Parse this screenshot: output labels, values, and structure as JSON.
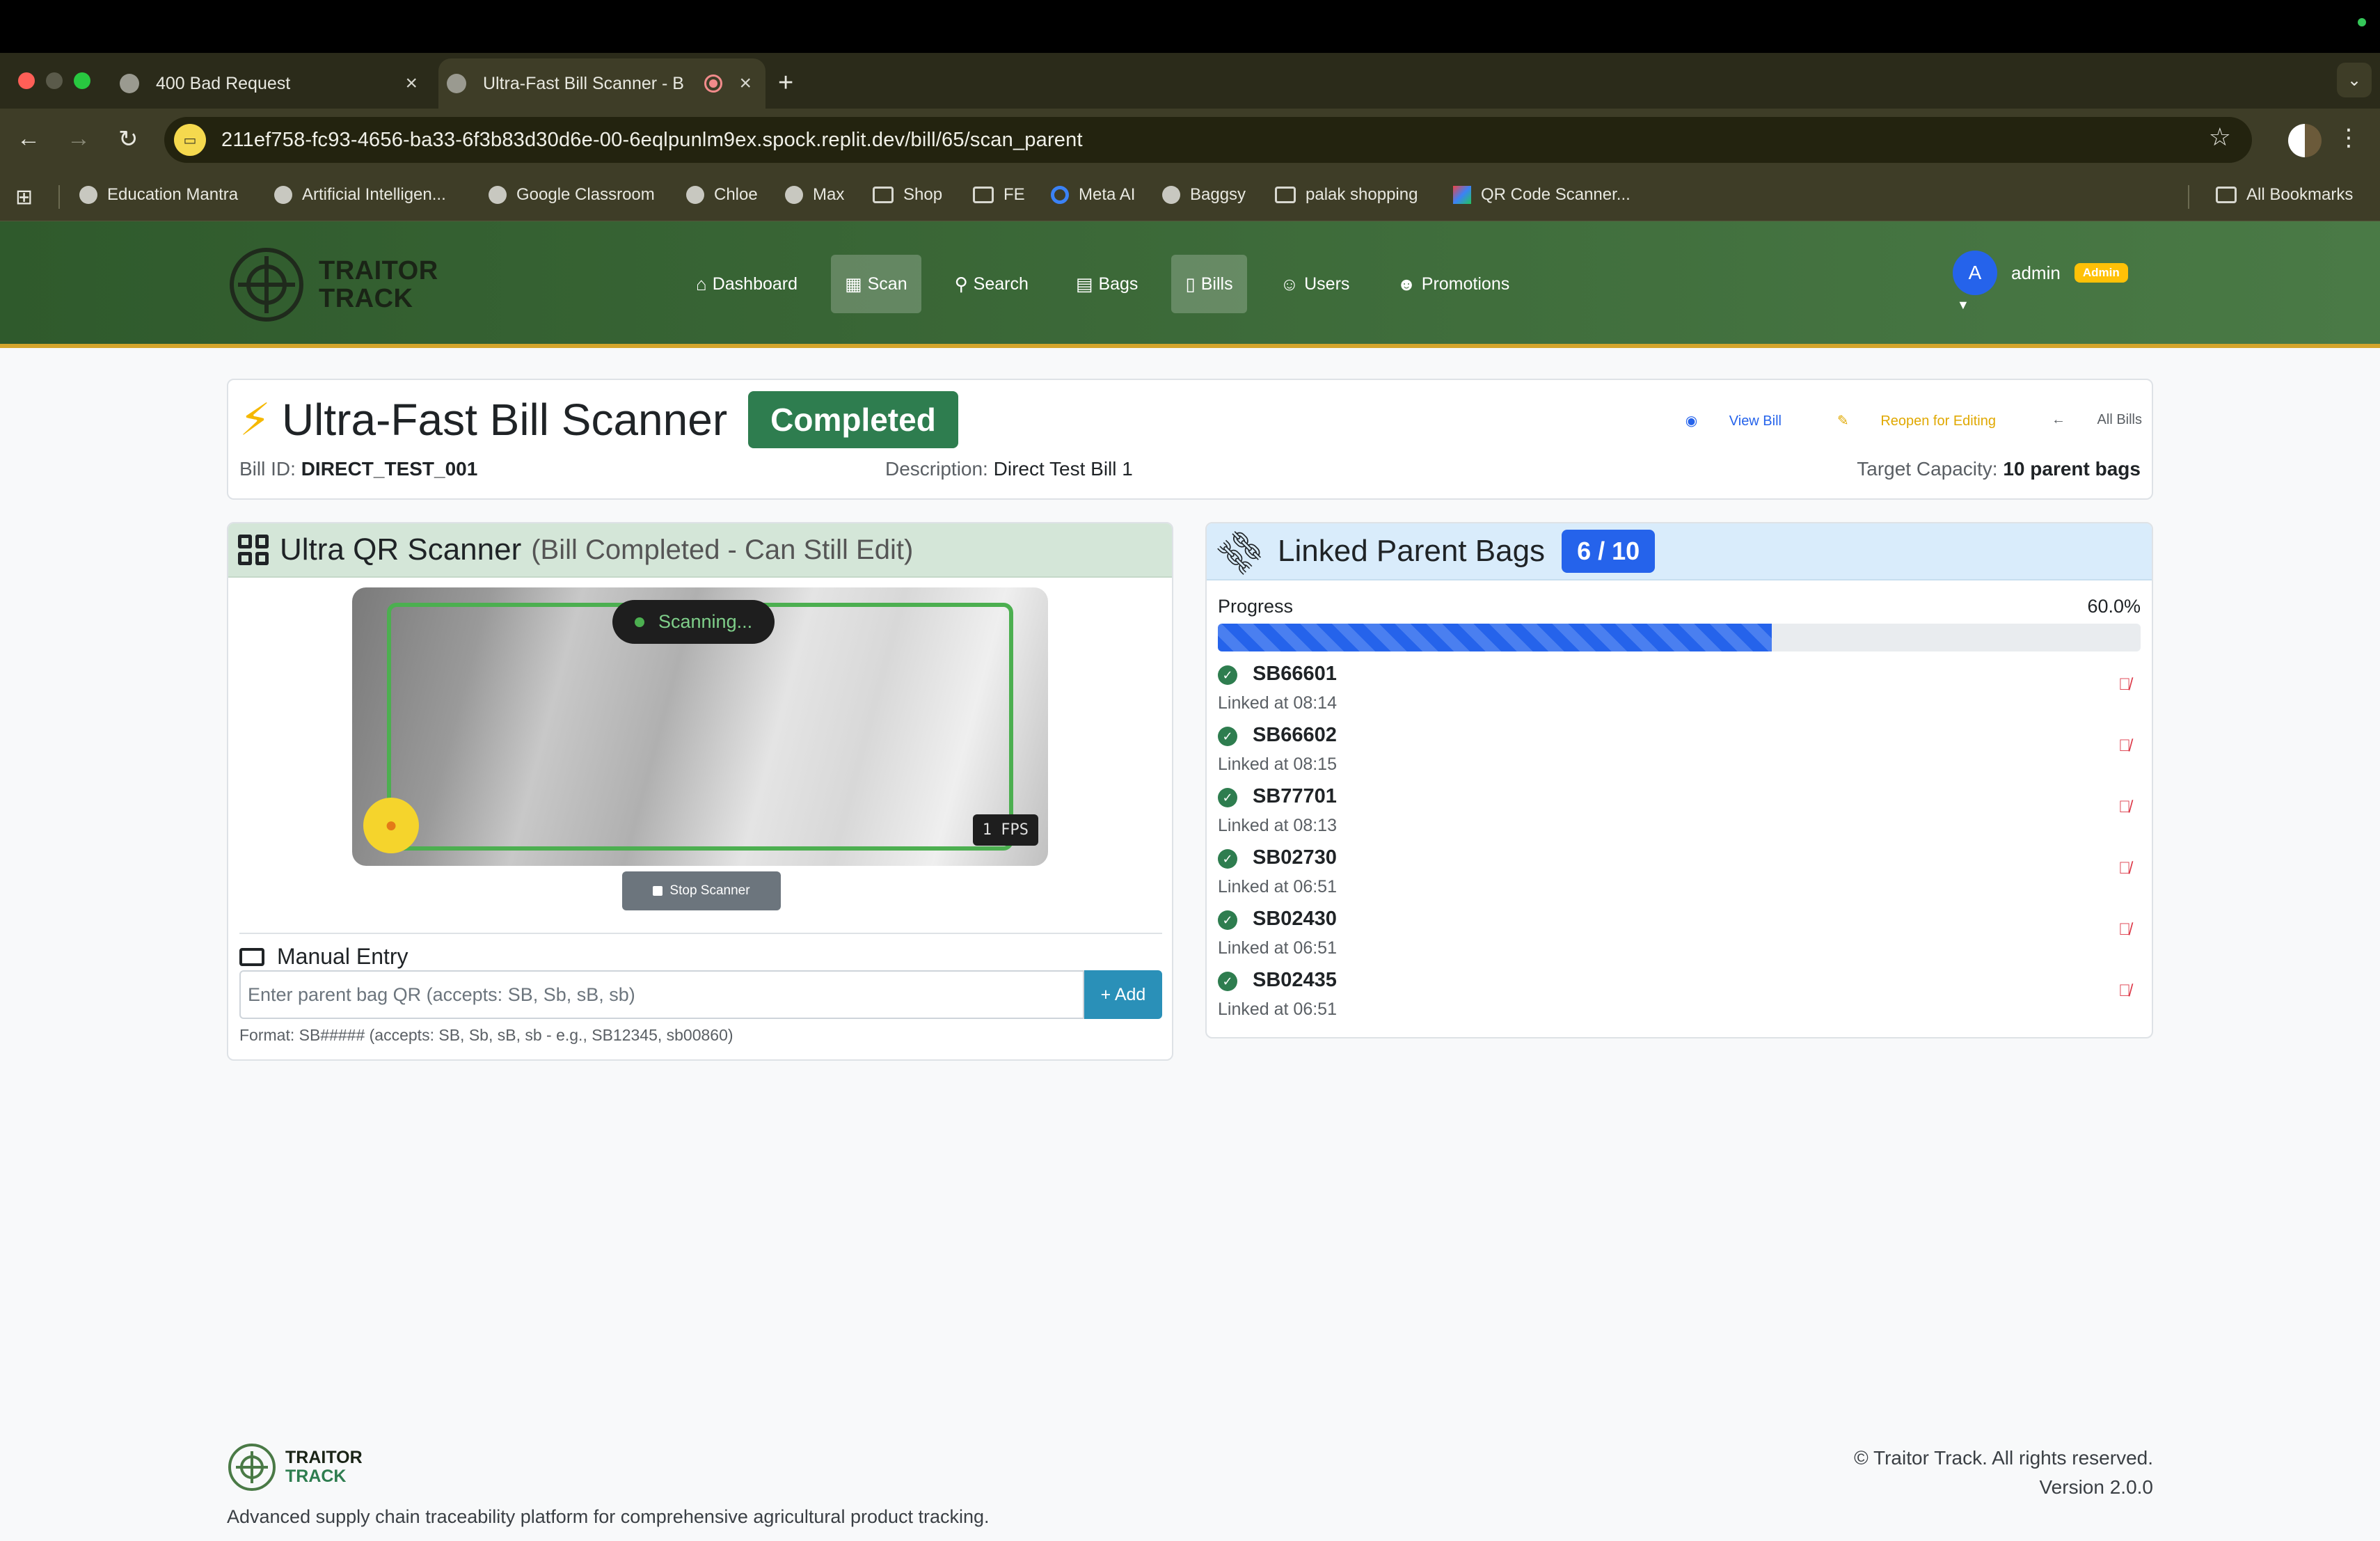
{
  "browser": {
    "tabs": [
      {
        "title": "400 Bad Request",
        "active": false
      },
      {
        "title": "Ultra-Fast Bill Scanner - B",
        "active": true
      }
    ],
    "url": "211ef758-fc93-4656-ba33-6f3b83d30d6e-00-6eqlpunlm9ex.spock.replit.dev/bill/65/scan_parent",
    "bookmarks": [
      {
        "label": "Education Mantra",
        "icon": "globe-icon"
      },
      {
        "label": "Artificial Intelligen...",
        "icon": "globe-icon"
      },
      {
        "label": "Google Classroom",
        "icon": "globe-icon"
      },
      {
        "label": "Chloe",
        "icon": "globe-icon"
      },
      {
        "label": "Max",
        "icon": "globe-icon"
      },
      {
        "label": "Shop",
        "icon": "folder-icon"
      },
      {
        "label": "FE",
        "icon": "folder-icon"
      },
      {
        "label": "Meta AI",
        "icon": "meta-ai-icon"
      },
      {
        "label": "Baggsy",
        "icon": "globe-icon"
      },
      {
        "label": "palak shopping",
        "icon": "folder-icon"
      },
      {
        "label": "QR Code Scanner...",
        "icon": "qr-scanner-icon"
      }
    ],
    "all_bookmarks": "All Bookmarks"
  },
  "app": {
    "brand": {
      "line1": "TRAITOR",
      "line2": "TRACK"
    },
    "nav": [
      {
        "label": "Dashboard",
        "icon": "home-icon",
        "active": false
      },
      {
        "label": "Scan",
        "icon": "qr-icon",
        "active": true
      },
      {
        "label": "Search",
        "icon": "search-icon",
        "active": false
      },
      {
        "label": "Bags",
        "icon": "boxes-icon",
        "active": false
      },
      {
        "label": "Bills",
        "icon": "file-icon",
        "active": true
      },
      {
        "label": "Users",
        "icon": "users-icon",
        "active": false
      },
      {
        "label": "Promotions",
        "icon": "user-cog-icon",
        "active": false
      }
    ],
    "user": {
      "initial": "A",
      "name": "admin",
      "role_badge": "Admin"
    }
  },
  "header": {
    "title": "Ultra-Fast Bill Scanner",
    "status": "Completed",
    "links": {
      "view": "View Bill",
      "reopen": "Reopen for Editing",
      "all": "All Bills"
    },
    "bill_id_label": "Bill ID:",
    "bill_id": "DIRECT_TEST_001",
    "description_label": "Description:",
    "description": "Direct Test Bill 1",
    "capacity_label": "Target Capacity:",
    "capacity": "10 parent bags"
  },
  "scanner": {
    "title": "Ultra QR Scanner",
    "subtitle": "(Bill Completed - Can Still Edit)",
    "status": "Scanning...",
    "fps": "1 FPS",
    "stop_label": "Stop Scanner",
    "manual_title": "Manual Entry",
    "input_placeholder": "Enter parent bag QR (accepts: SB, Sb, sB, sb)",
    "add_label": "+ Add",
    "format_note": "Format: SB##### (accepts: SB, Sb, sB, sb - e.g., SB12345, sb00860)"
  },
  "linked": {
    "title": "Linked Parent Bags",
    "count": "6 / 10",
    "progress_label": "Progress",
    "progress_text": "60.0%",
    "progress_value": 0.6,
    "bags": [
      {
        "code": "SB66601",
        "time": "Linked at 08:14"
      },
      {
        "code": "SB66602",
        "time": "Linked at 08:15"
      },
      {
        "code": "SB77701",
        "time": "Linked at 08:13"
      },
      {
        "code": "SB02730",
        "time": "Linked at 06:51"
      },
      {
        "code": "SB02430",
        "time": "Linked at 06:51"
      },
      {
        "code": "SB02435",
        "time": "Linked at 06:51"
      }
    ]
  },
  "footer": {
    "brand": {
      "line1": "TRAITOR",
      "line2": "TRACK"
    },
    "tagline": "Advanced supply chain traceability platform for comprehensive agricultural product tracking.",
    "copyright": "© Traitor Track. All rights reserved.",
    "version": "Version 2.0.0"
  },
  "colors": {
    "nav_gradient_start": "#2f5a2c",
    "nav_gradient_end": "#4a7a46",
    "completed": "#2e7d4f",
    "progress": "#2563eb",
    "add_button": "#2a90b8",
    "unlink": "#dc3545"
  }
}
